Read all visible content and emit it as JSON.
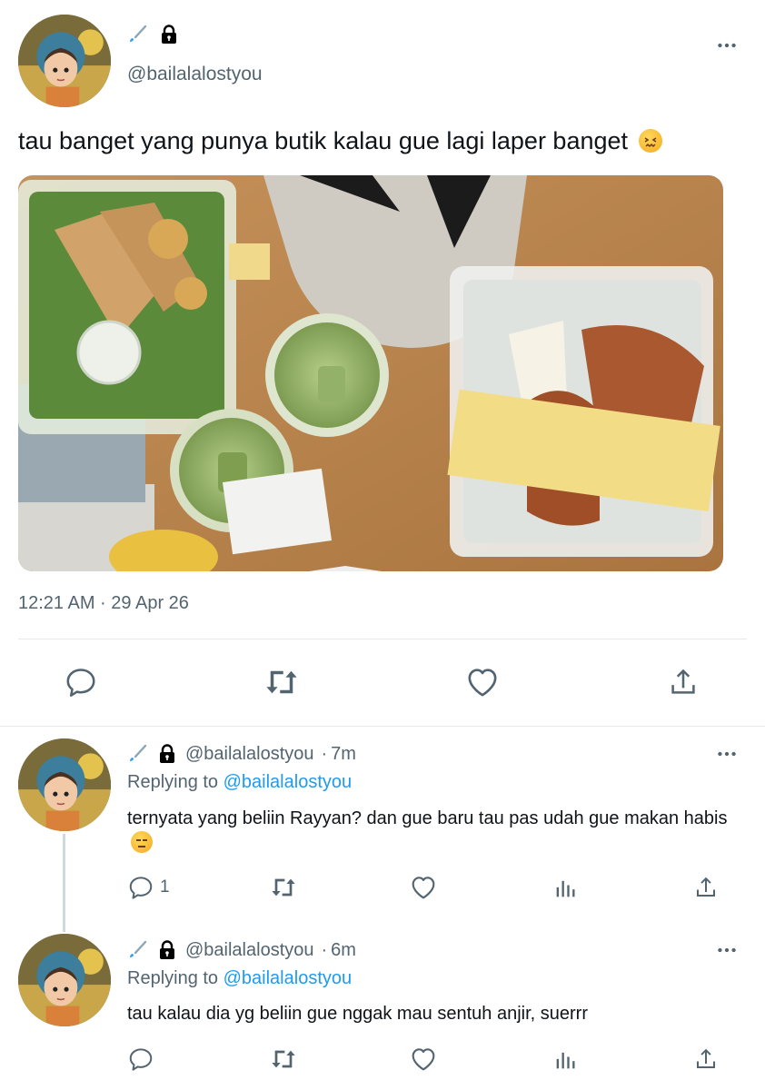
{
  "main_tweet": {
    "handle": "@bailalalostyou",
    "text": "tau banget yang punya butik kalau gue lagi laper banget",
    "emoji": "😖",
    "timestamp": "12:21 AM · 29 Apr 26",
    "image_alt": "food photo"
  },
  "replies": [
    {
      "handle": "@bailalalostyou",
      "time": "7m",
      "replying_label": "Replying to",
      "replying_handle": "@bailalalostyou",
      "text": "ternyata yang beliin Rayyan? dan gue baru tau pas udah gue makan habis",
      "emoji": "😑",
      "reply_count": "1"
    },
    {
      "handle": "@bailalalostyou",
      "time": "6m",
      "replying_label": "Replying to",
      "replying_handle": "@bailalalostyou",
      "text": "tau kalau dia yg beliin gue nggak mau sentuh anjir, suerrr",
      "reply_count": ""
    }
  ],
  "colors": {
    "link": "#1d9bf0",
    "muted": "#536471",
    "divider": "#e6e9ea"
  },
  "icons": [
    "brush-icon",
    "lock-icon",
    "more-icon",
    "reply-icon",
    "retweet-icon",
    "like-icon",
    "share-icon",
    "views-icon"
  ]
}
